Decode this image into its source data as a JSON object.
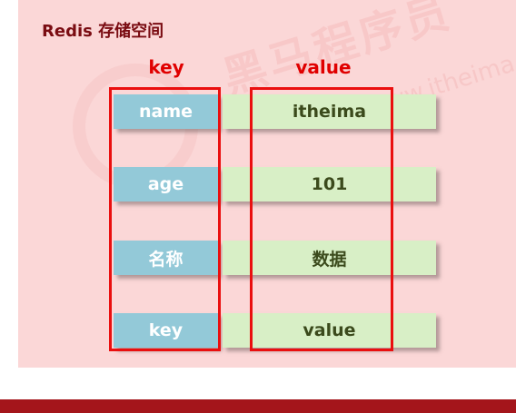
{
  "title": "Redis 存储空间",
  "headers": {
    "key": "key",
    "value": "value"
  },
  "rows": [
    {
      "key": "name",
      "value": "itheima"
    },
    {
      "key": "age",
      "value": "101"
    },
    {
      "key": "名称",
      "value": "数据"
    },
    {
      "key": "key",
      "value": "value"
    }
  ],
  "colors": {
    "panel": "#fbd7d7",
    "title": "#7a0c12",
    "header": "#e00000",
    "key_cell": "#93c9d8",
    "value_cell": "#d8efc6",
    "frame": "#ea0f0f",
    "bottom_bar": "#a4151b"
  }
}
